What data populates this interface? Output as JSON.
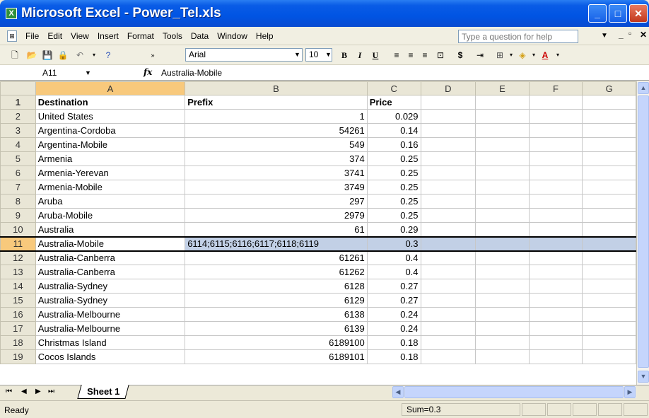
{
  "window": {
    "title": "Microsoft Excel - Power_Tel.xls",
    "app_icon_glyph": "X",
    "minimize": "_",
    "maximize": "□",
    "close": "✕"
  },
  "menu": {
    "items": [
      "File",
      "Edit",
      "View",
      "Insert",
      "Format",
      "Tools",
      "Data",
      "Window",
      "Help"
    ],
    "help_placeholder": "Type a question for help"
  },
  "toolbar": {
    "font": "Arial",
    "size": "10",
    "bold": "B",
    "italic": "I",
    "underline": "U",
    "currency": "$"
  },
  "formula_bar": {
    "name_box": "A11",
    "fx": "fx",
    "formula": "Australia-Mobile"
  },
  "grid": {
    "columns": [
      "A",
      "B",
      "C",
      "D",
      "E",
      "F",
      "G"
    ],
    "selected_row": 11,
    "rows": [
      {
        "n": "1",
        "a": "Destination",
        "b": "Prefix",
        "c": "Price",
        "bold": true,
        "b_left": true,
        "c_left": true
      },
      {
        "n": "2",
        "a": "United States",
        "b": "1",
        "c": "0.029"
      },
      {
        "n": "3",
        "a": "Argentina-Cordoba",
        "b": "54261",
        "c": "0.14"
      },
      {
        "n": "4",
        "a": "Argentina-Mobile",
        "b": "549",
        "c": "0.16"
      },
      {
        "n": "5",
        "a": "Armenia",
        "b": "374",
        "c": "0.25"
      },
      {
        "n": "6",
        "a": "Armenia-Yerevan",
        "b": "3741",
        "c": "0.25"
      },
      {
        "n": "7",
        "a": "Armenia-Mobile",
        "b": "3749",
        "c": "0.25"
      },
      {
        "n": "8",
        "a": "Aruba",
        "b": "297",
        "c": "0.25"
      },
      {
        "n": "9",
        "a": "Aruba-Mobile",
        "b": "2979",
        "c": "0.25"
      },
      {
        "n": "10",
        "a": "Australia",
        "b": "61",
        "c": "0.29"
      },
      {
        "n": "11",
        "a": "Australia-Mobile",
        "b": "6114;6115;6116;6117;6118;6119",
        "c": "0.3",
        "b_left": true,
        "selected": true
      },
      {
        "n": "12",
        "a": "Australia-Canberra",
        "b": "61261",
        "c": "0.4"
      },
      {
        "n": "13",
        "a": "Australia-Canberra",
        "b": "61262",
        "c": "0.4"
      },
      {
        "n": "14",
        "a": "Australia-Sydney",
        "b": "6128",
        "c": "0.27"
      },
      {
        "n": "15",
        "a": "Australia-Sydney",
        "b": "6129",
        "c": "0.27"
      },
      {
        "n": "16",
        "a": "Australia-Melbourne",
        "b": "6138",
        "c": "0.24"
      },
      {
        "n": "17",
        "a": "Australia-Melbourne",
        "b": "6139",
        "c": "0.24"
      },
      {
        "n": "18",
        "a": "Christmas Island",
        "b": "6189100",
        "c": "0.18"
      },
      {
        "n": "19",
        "a": "Cocos Islands",
        "b": "6189101",
        "c": "0.18"
      }
    ]
  },
  "sheet_tab": "Sheet 1",
  "status": {
    "text": "Ready",
    "sum": "Sum=0.3"
  }
}
